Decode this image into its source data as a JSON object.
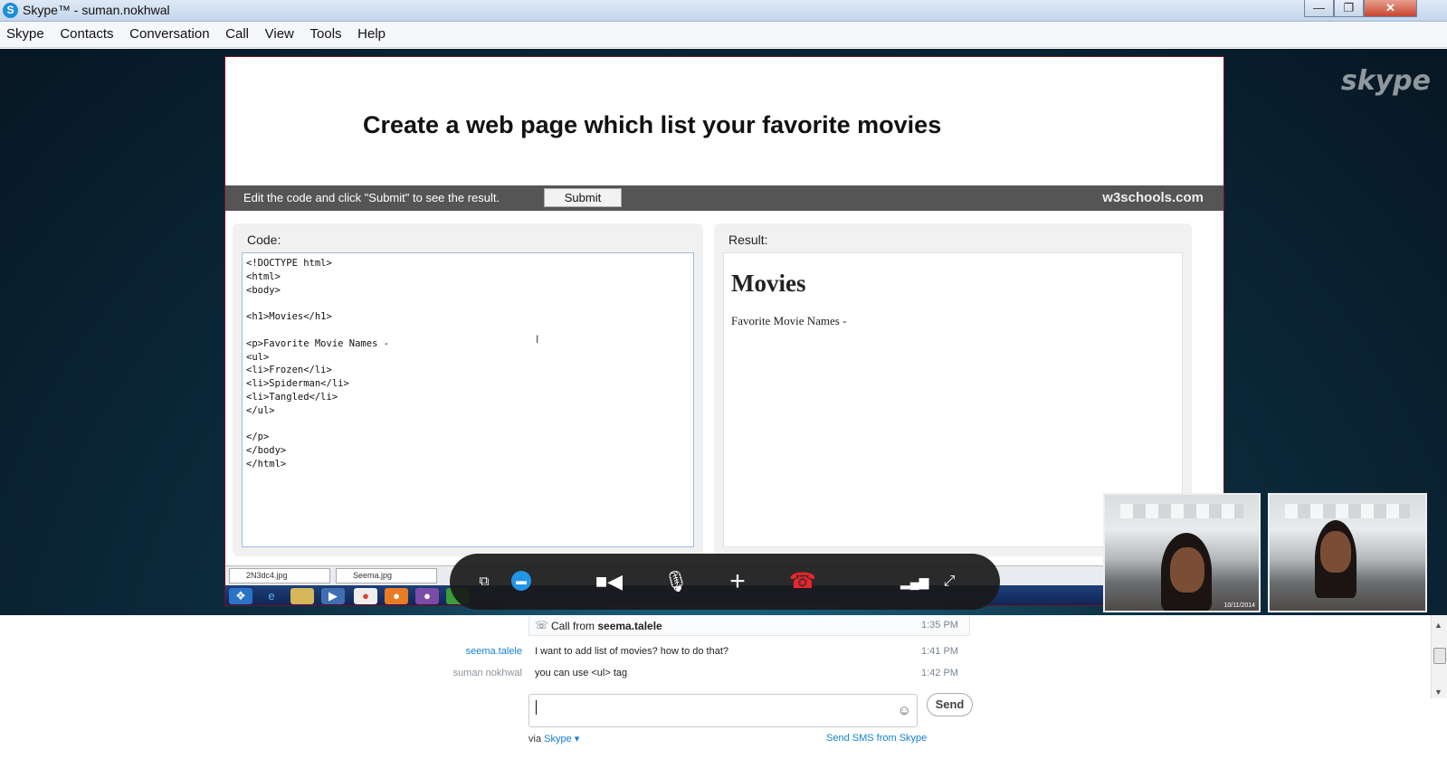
{
  "window": {
    "title": "Skype™ - suman.nokhwal",
    "logo_glyph": "S",
    "minimize_glyph": "—",
    "maximize_glyph": "❐",
    "close_glyph": "✕"
  },
  "menu": [
    "Skype",
    "Contacts",
    "Conversation",
    "Call",
    "View",
    "Tools",
    "Help"
  ],
  "watermark": "skype",
  "shared_screen": {
    "heading": "Create a web page which list your favorite movies",
    "toolbar_hint": "Edit the code and click \"Submit\" to see the result.",
    "submit_label": "Submit",
    "brand": "w3schools.com",
    "code_label": "Code:",
    "result_label": "Result:",
    "code_lines": [
      "<!DOCTYPE html>",
      "<html>",
      "<body>",
      "",
      "<h1>Movies</h1>",
      "",
      "<p>Favorite Movie Names -",
      "<ul>",
      "<li>Frozen</li>",
      "<li>Spiderman</li>",
      "<li>Tangled</li>",
      "</ul>",
      "",
      "</p>",
      "</body>",
      "</html>"
    ],
    "result_heading": "Movies",
    "result_text": "Favorite Movie Names -",
    "file_tabs": [
      "2N3dc4.jpg",
      "Seema.jpg"
    ]
  },
  "call_controls": {
    "share_icon": "share-screen-icon",
    "chat_icon": "chat-icon",
    "video_icon": "video-camera-icon",
    "mic_icon": "microphone-icon",
    "add_icon": "add-icon",
    "hangup_icon": "hang-up-icon",
    "signal_icon": "call-quality-icon",
    "fullscreen_icon": "fullscreen-icon",
    "hangup_color": "#e8262b"
  },
  "video_feeds": {
    "stamp": "10/11/2014"
  },
  "chat": {
    "call_notice_prefix": "Call from ",
    "call_notice_name": "seema.talele",
    "call_time": "1:35 PM",
    "messages": [
      {
        "sender": "seema.talele",
        "text": "I want to add list of movies? how to do that?",
        "time": "1:41 PM",
        "sender_color": "#1580d0"
      },
      {
        "sender": "suman nokhwal",
        "text": "you can use <ul> tag",
        "time": "1:42 PM",
        "sender_color": "#8a939c"
      }
    ],
    "input_value": "",
    "send_label": "Send",
    "via_prefix": "via ",
    "via_link": "Skype",
    "sms_link": "Send SMS from Skype"
  }
}
